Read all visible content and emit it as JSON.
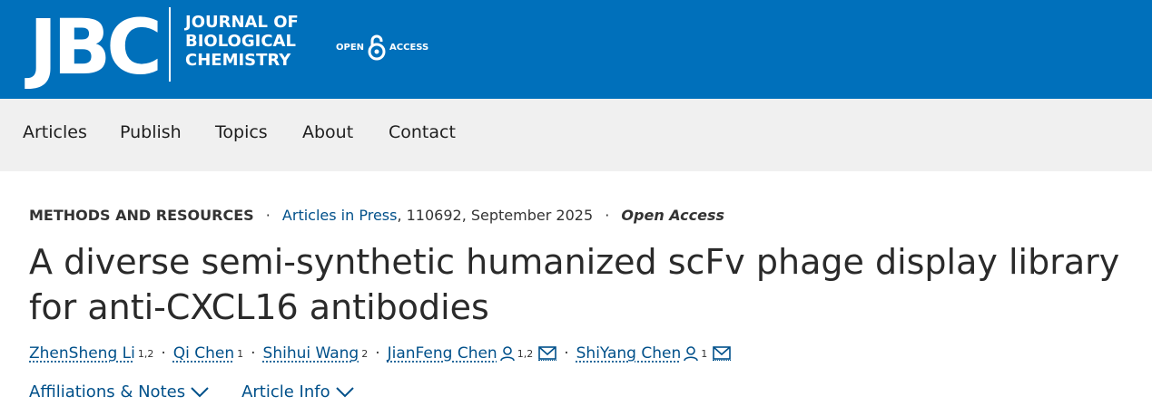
{
  "header": {
    "logo_text": "JBC",
    "journal_line1": "JOURNAL OF",
    "journal_line2": "BIOLOGICAL",
    "journal_line3": "CHEMISTRY",
    "oa_left": "OPEN",
    "oa_right": "ACCESS",
    "bg_color": "#0070bb"
  },
  "nav": {
    "items": [
      {
        "label": "Articles"
      },
      {
        "label": "Publish"
      },
      {
        "label": "Topics"
      },
      {
        "label": "About"
      },
      {
        "label": "Contact"
      }
    ]
  },
  "article": {
    "type": "METHODS AND RESOURCES",
    "issue_link": "Articles in Press",
    "issue_rest": ", 110692, September 2025",
    "access": "Open Access",
    "title": "A diverse semi-synthetic humanized scFv phage display library for anti-CXCL16 antibodies",
    "authors": [
      {
        "name": "ZhenSheng Li",
        "affil": "1,2"
      },
      {
        "name": "Qi Chen",
        "affil": "1"
      },
      {
        "name": "Shihui Wang",
        "affil": "2"
      },
      {
        "name": "JianFeng Chen",
        "affil": "1,2"
      },
      {
        "name": "ShiYang Chen",
        "affil": "1"
      }
    ],
    "affiliations_label": "Affiliations & Notes",
    "article_info_label": "Article Info",
    "link_color": "#00508a"
  }
}
